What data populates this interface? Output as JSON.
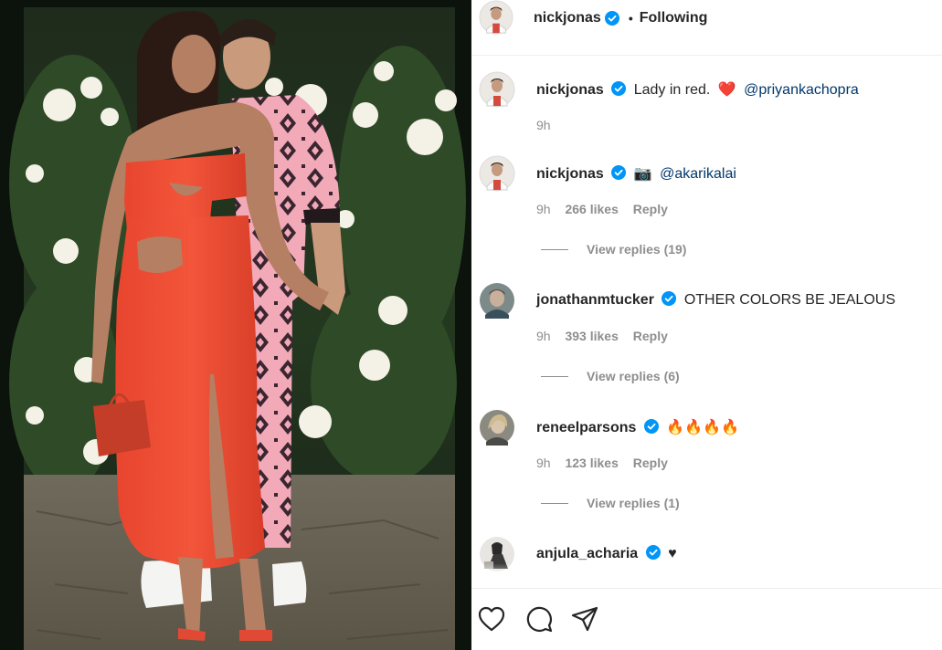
{
  "post": {
    "author": "nickjonas",
    "follow_state": "Following",
    "separator": "•"
  },
  "comments": [
    {
      "username": "nickjonas",
      "text": "Lady in red.",
      "emoji": "❤️",
      "mention": "@priyankachopra",
      "time": "9h"
    },
    {
      "username": "nickjonas",
      "emoji": "📷",
      "mention": "@akarikalai",
      "time": "9h",
      "likes": "266 likes",
      "reply": "Reply",
      "view_replies": "View replies (19)"
    },
    {
      "username": "jonathanmtucker",
      "text": "OTHER COLORS BE JEALOUS",
      "time": "9h",
      "likes": "393 likes",
      "reply": "Reply",
      "view_replies": "View replies (6)"
    },
    {
      "username": "reneelparsons",
      "text": "🔥🔥🔥🔥",
      "time": "9h",
      "likes": "123 likes",
      "reply": "Reply",
      "view_replies": "View replies (1)"
    },
    {
      "username": "anjula_acharia",
      "text": "♥"
    }
  ],
  "icons": {
    "like": "heart-icon",
    "comment": "comment-icon",
    "share": "share-icon",
    "verified": "verified-badge-icon"
  },
  "colors": {
    "verified_blue": "#0095f6",
    "mention_blue": "#00376b",
    "meta_gray": "#8e8e8e",
    "heart_red": "#ed4956"
  }
}
